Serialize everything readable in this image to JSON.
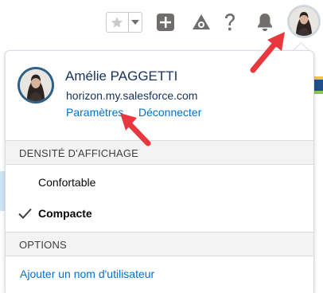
{
  "header": {
    "icons": [
      "star-icon",
      "chevron-down-icon",
      "add-icon",
      "trailhead-icon",
      "help-icon",
      "notifications-bell-icon"
    ]
  },
  "user": {
    "name": "Amélie PAGGETTI",
    "domain": "horizon.my.salesforce.com",
    "settings_link": "Paramètres",
    "logout_link": "Déconnecter"
  },
  "display_density": {
    "header": "DENSITÉ D'AFFICHAGE",
    "options": [
      {
        "label": "Confortable",
        "selected": false
      },
      {
        "label": "Compacte",
        "selected": true
      }
    ]
  },
  "options": {
    "header": "OPTIONS",
    "add_username": "Ajouter un nom d'utilisateur"
  },
  "colors": {
    "link": "#0070d2",
    "text": "#16325c",
    "annotation_arrow": "#e8383d",
    "section_bg": "#f3f3f3"
  }
}
